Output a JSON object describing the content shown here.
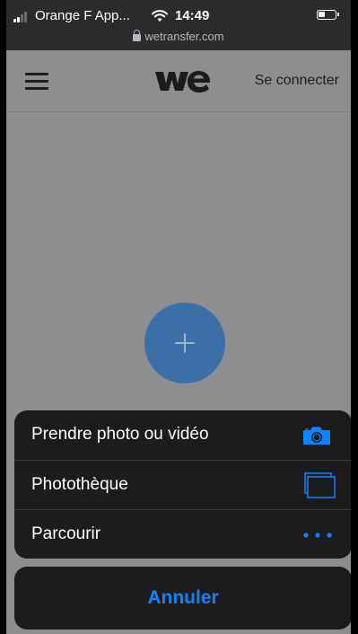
{
  "status_bar": {
    "carrier": "Orange F App...",
    "time": "14:49",
    "url": "wetransfer.com"
  },
  "header": {
    "menu_icon": "hamburger-icon",
    "logo_icon": "wetransfer-logo",
    "login_label": "Se connecter"
  },
  "main": {
    "add_icon": "plus-icon"
  },
  "action_sheet": {
    "items": [
      {
        "label": "Prendre photo ou vidéo",
        "icon": "camera-icon"
      },
      {
        "label": "Photothèque",
        "icon": "photo-library-icon"
      },
      {
        "label": "Parcourir",
        "icon": "more-icon"
      }
    ],
    "cancel_label": "Annuler"
  },
  "colors": {
    "accent": "#0a84ff",
    "plus_button": "#3b6fa8",
    "sheet_bg": "#1c1c1e",
    "dimmed_page": "#8e8e90"
  }
}
